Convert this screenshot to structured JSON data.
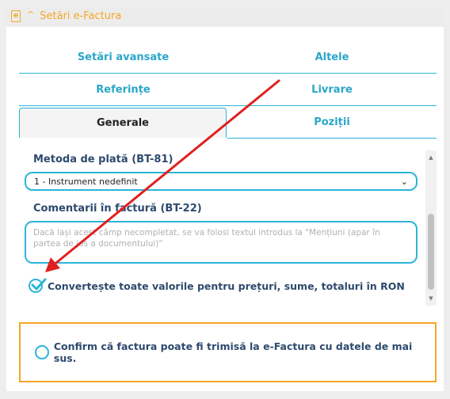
{
  "header": {
    "icon": "e-document-icon",
    "title": "Setări e-Factura"
  },
  "tabs": [
    {
      "label": "Setări avansate"
    },
    {
      "label": "Altele"
    },
    {
      "label": "Referințe"
    },
    {
      "label": "Livrare"
    },
    {
      "label": "Generale",
      "active": true
    },
    {
      "label": "Poziții"
    }
  ],
  "form": {
    "payment_label": "Metoda de plată (BT-81)",
    "payment_value": "1 - Instrument nedefinit",
    "comments_label": "Comentarii în factură (BT-22)",
    "comments_placeholder": "Dacă lași acest câmp necompletat, se va folosi textul introdus la \"Mențiuni (apar în partea de jos a documentului)\"",
    "convert_label": "Convertește toate valorile pentru prețuri, sume, totaluri în RON",
    "convert_checked": true
  },
  "confirm": {
    "label": "Confirm că factura poate fi trimisă la e-Factura cu datele de mai sus.",
    "checked": false
  },
  "colors": {
    "accent": "#2bb5d8",
    "orange": "#f5a623",
    "text": "#2d4a6e",
    "annotation_arrow": "#e02020"
  }
}
